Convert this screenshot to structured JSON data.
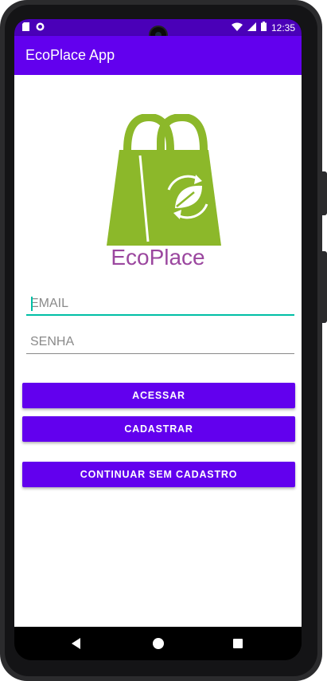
{
  "status_bar": {
    "time": "12:35",
    "left_icons": [
      "sd-card-icon",
      "notification-icon"
    ],
    "right_icons": [
      "wifi-icon",
      "cell-signal-icon",
      "battery-icon"
    ]
  },
  "app_bar": {
    "title": "EcoPlace App"
  },
  "logo": {
    "text": "EcoPlace",
    "text_color": "#9b479f",
    "bag_color": "#8cb82a"
  },
  "form": {
    "email": {
      "placeholder": "EMAIL",
      "value": ""
    },
    "password": {
      "placeholder": "SENHA",
      "value": ""
    }
  },
  "buttons": {
    "login": "ACESSAR",
    "register": "CADASTRAR",
    "guest": "CONTINUAR SEM CADASTRO"
  },
  "nav_bar": {
    "icons": [
      "back-icon",
      "home-icon",
      "recents-icon"
    ]
  },
  "colors": {
    "primary": "#6200ee",
    "primary_dark": "#4a00b8",
    "accent": "#00bfa5"
  }
}
